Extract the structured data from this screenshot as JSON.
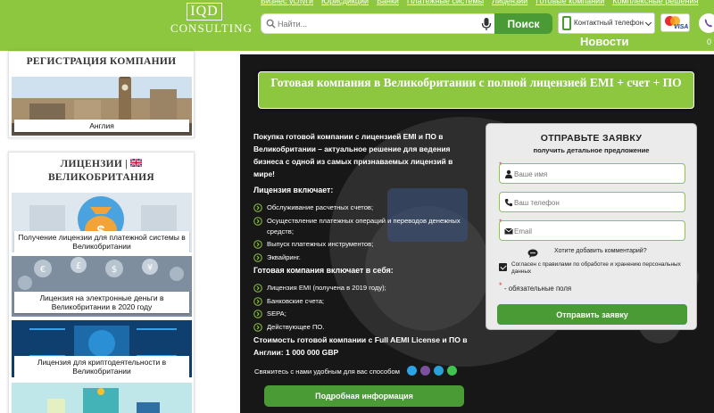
{
  "header": {
    "logo_box": "IQD",
    "logo_text": "CONSULTING",
    "nav": [
      "Бизнес услуги",
      "Юрисдикции",
      "Банки",
      "Платежные системы",
      "Лицензии",
      "Готовые компании",
      "Комплексные решения"
    ],
    "search_placeholder": "Найти...",
    "search_button": "Поиск",
    "contact_select": "Контактный телефон",
    "news": "Новости",
    "counter": "0",
    "colors": {
      "brand_green": "#8dc63f",
      "button_green": "#4a9a36"
    }
  },
  "sidebar": {
    "registration_title": "РЕГИСТРАЦИЯ КОМПАНИИ",
    "registration_item": "Англия",
    "licenses_title_1": "ЛИЦЕНЗИИ |",
    "licenses_title_2": "ВЕЛИКОБРИТАНИЯ",
    "flag_icon": "uk-flag-icon",
    "license_items": [
      "Получение лицензии для платежной системы в Великобритании",
      "Лицензия на электронные деньги в Великобритании в 2020 году",
      "Лицензия для криптодеятельности в Великобритании"
    ]
  },
  "main": {
    "title": "Готовая компания в Великобритании с полной лицензией EMI + счет + ПО",
    "intro": "Покупка готовой компании с лицензией EMI и ПО в Великобритании – актуальное решение для ведения бизнеса с одной из самых признаваемых лицензий в мире!",
    "license_includes_label": "Лицензия включает:",
    "license_includes": [
      "Обслуживание расчетных счетов;",
      "Осуществление платежных операций и переводов денежных средств;",
      "Выпуск платежных инструментов;",
      "Эквайринг."
    ],
    "company_includes_label": "Готовая компания включает в себя:",
    "company_includes": [
      "Лицензия EMI (получена в 2019 году);",
      "Банковские счета;",
      "SEPA;",
      "Действующее ПО."
    ],
    "price": "Стоимость готовой компании с Full AEMI License и ПО в Англии: 1 000 000 GBP",
    "contact_line": "Свяжитесь с нами удобным для вас способом",
    "messenger_icons": [
      "skype-icon",
      "viber-icon",
      "telegram-icon",
      "whatsapp-icon"
    ],
    "detail_button": "Подробная информация"
  },
  "form": {
    "title": "ОТПРАВЬТЕ ЗАЯВКУ",
    "subtitle": "получить детальное предложение",
    "name_placeholder": "Ваше имя",
    "phone_placeholder": "Ваш телефон",
    "email_placeholder": "Email",
    "comment_question": "Хотите добавить комментарий?",
    "agree_text": "Согласен с правилами по обработке и хранению персональных данных",
    "agree_checked": true,
    "required_mark": "*",
    "required_note": "- обязательные поля",
    "submit": "Отправить заявку"
  }
}
